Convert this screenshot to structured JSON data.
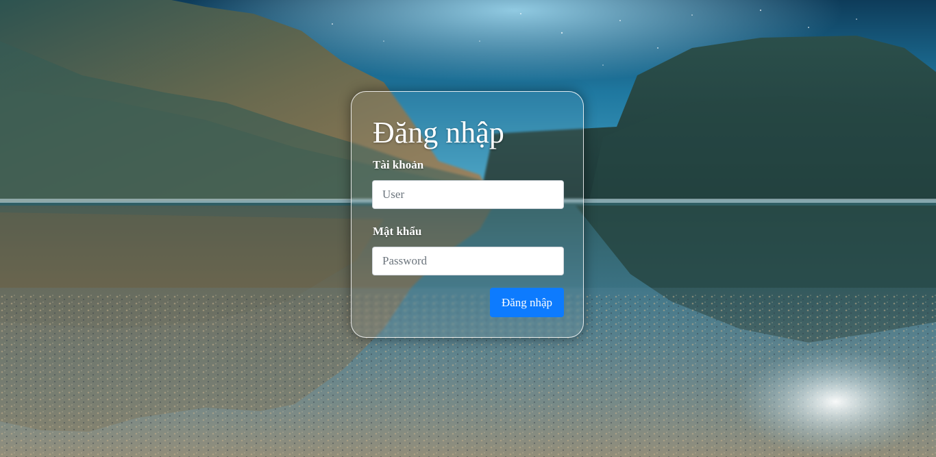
{
  "login": {
    "title": "Đăng nhập",
    "username_label": "Tài khoản",
    "username_placeholder": "User",
    "username_value": "",
    "password_label": "Mật khẩu",
    "password_placeholder": "Password",
    "password_value": "",
    "submit_label": "Đăng nhập"
  },
  "colors": {
    "submit_button": "#0d7bfe",
    "sky": "#1f6f93",
    "water": "#3c7f9a",
    "mountains": "#2d5a54"
  }
}
